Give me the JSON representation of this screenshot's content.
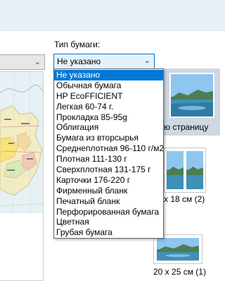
{
  "paper_type": {
    "label": "Тип бумаги:",
    "selected": "Не указано",
    "options": [
      "Не указано",
      "Обычная бумага",
      "HP EcoFFICIENT",
      "Легкая 60-74 г.",
      "Прокладка 85-95g",
      "Облигация",
      "Бумага из вторсырья",
      "Среднеплотная 96-110 г/м2",
      "Плотная 111-130 г",
      "Сверхплотная 131-175 г",
      "Карточки 176-220 г",
      "Фирменный бланк",
      "Печатный бланк",
      "Перфорированная бумага",
      "Цветная",
      "Грубая бумага"
    ]
  },
  "layouts": {
    "full_page_caption": "ю страницу",
    "size_13x18_caption": "x 18 см (2)",
    "size_20x25_caption": "20 x 25 см (1)"
  },
  "colors": {
    "accent": "#0078d7",
    "topbar": "#e9f0f8"
  }
}
